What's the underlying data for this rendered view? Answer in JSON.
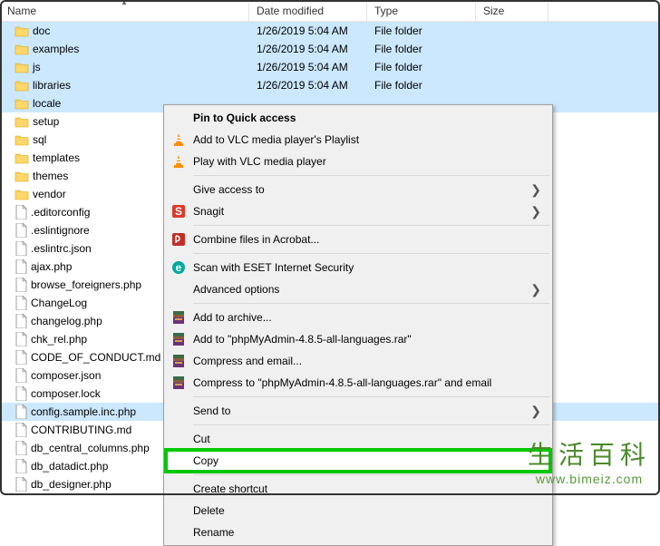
{
  "columns": {
    "name": "Name",
    "date": "Date modified",
    "type": "Type",
    "size": "Size"
  },
  "files": [
    {
      "icon": "folder",
      "name": "doc",
      "date": "1/26/2019 5:04 AM",
      "type": "File folder",
      "selected": true
    },
    {
      "icon": "folder",
      "name": "examples",
      "date": "1/26/2019 5:04 AM",
      "type": "File folder",
      "selected": true
    },
    {
      "icon": "folder",
      "name": "js",
      "date": "1/26/2019 5:04 AM",
      "type": "File folder",
      "selected": true
    },
    {
      "icon": "folder",
      "name": "libraries",
      "date": "1/26/2019 5:04 AM",
      "type": "File folder",
      "selected": true
    },
    {
      "icon": "folder",
      "name": "locale",
      "date": "",
      "type": "",
      "selected": true
    },
    {
      "icon": "folder",
      "name": "setup",
      "date": "",
      "type": "",
      "selected": false
    },
    {
      "icon": "folder",
      "name": "sql",
      "date": "",
      "type": "",
      "selected": false
    },
    {
      "icon": "folder",
      "name": "templates",
      "date": "",
      "type": "",
      "selected": false
    },
    {
      "icon": "folder",
      "name": "themes",
      "date": "",
      "type": "",
      "selected": false
    },
    {
      "icon": "folder",
      "name": "vendor",
      "date": "",
      "type": "",
      "selected": false
    },
    {
      "icon": "file",
      "name": ".editorconfig",
      "date": "",
      "type": "",
      "selected": false
    },
    {
      "icon": "file",
      "name": ".eslintignore",
      "date": "",
      "type": "",
      "selected": false
    },
    {
      "icon": "file",
      "name": ".eslintrc.json",
      "date": "",
      "type": "",
      "selected": false
    },
    {
      "icon": "file",
      "name": "ajax.php",
      "date": "",
      "type": "",
      "selected": false
    },
    {
      "icon": "file",
      "name": "browse_foreigners.php",
      "date": "",
      "type": "",
      "selected": false
    },
    {
      "icon": "file",
      "name": "ChangeLog",
      "date": "",
      "type": "",
      "selected": false
    },
    {
      "icon": "file",
      "name": "changelog.php",
      "date": "",
      "type": "",
      "selected": false
    },
    {
      "icon": "file",
      "name": "chk_rel.php",
      "date": "",
      "type": "",
      "selected": false
    },
    {
      "icon": "file",
      "name": "CODE_OF_CONDUCT.md",
      "date": "",
      "type": "",
      "selected": false
    },
    {
      "icon": "file",
      "name": "composer.json",
      "date": "",
      "type": "",
      "selected": false
    },
    {
      "icon": "file",
      "name": "composer.lock",
      "date": "",
      "type": "",
      "selected": false
    },
    {
      "icon": "file",
      "name": "config.sample.inc.php",
      "date": "",
      "type": "",
      "selected": true
    },
    {
      "icon": "file",
      "name": "CONTRIBUTING.md",
      "date": "",
      "type": "",
      "selected": false
    },
    {
      "icon": "file",
      "name": "db_central_columns.php",
      "date": "",
      "type": "",
      "selected": false
    },
    {
      "icon": "file",
      "name": "db_datadict.php",
      "date": "",
      "type": "",
      "selected": false
    },
    {
      "icon": "file",
      "name": "db_designer.php",
      "date": "",
      "type": "",
      "selected": false
    }
  ],
  "menu": [
    {
      "kind": "item",
      "icon": "",
      "label": "Pin to Quick access",
      "bold": true
    },
    {
      "kind": "item",
      "icon": "vlc",
      "label": "Add to VLC media player's Playlist"
    },
    {
      "kind": "item",
      "icon": "vlc",
      "label": "Play with VLC media player"
    },
    {
      "kind": "sep"
    },
    {
      "kind": "item",
      "icon": "",
      "label": "Give access to",
      "submenu": true
    },
    {
      "kind": "item",
      "icon": "snagit",
      "label": "Snagit",
      "submenu": true
    },
    {
      "kind": "sep"
    },
    {
      "kind": "item",
      "icon": "acrobat",
      "label": "Combine files in Acrobat..."
    },
    {
      "kind": "sep"
    },
    {
      "kind": "item",
      "icon": "eset",
      "label": "Scan with ESET Internet Security"
    },
    {
      "kind": "item",
      "icon": "",
      "label": "Advanced options",
      "submenu": true
    },
    {
      "kind": "sep"
    },
    {
      "kind": "item",
      "icon": "rar",
      "label": "Add to archive..."
    },
    {
      "kind": "item",
      "icon": "rar",
      "label": "Add to \"phpMyAdmin-4.8.5-all-languages.rar\""
    },
    {
      "kind": "item",
      "icon": "rar",
      "label": "Compress and email..."
    },
    {
      "kind": "item",
      "icon": "rar",
      "label": "Compress to \"phpMyAdmin-4.8.5-all-languages.rar\" and email"
    },
    {
      "kind": "sep"
    },
    {
      "kind": "item",
      "icon": "",
      "label": "Send to",
      "submenu": true
    },
    {
      "kind": "sep"
    },
    {
      "kind": "item",
      "icon": "",
      "label": "Cut"
    },
    {
      "kind": "item",
      "icon": "",
      "label": "Copy",
      "highlighted": true
    },
    {
      "kind": "sep"
    },
    {
      "kind": "item",
      "icon": "",
      "label": "Create shortcut"
    },
    {
      "kind": "item",
      "icon": "",
      "label": "Delete"
    },
    {
      "kind": "item",
      "icon": "",
      "label": "Rename"
    }
  ],
  "watermark": {
    "title": "生活百科",
    "url": "www.bimeiz.com"
  }
}
